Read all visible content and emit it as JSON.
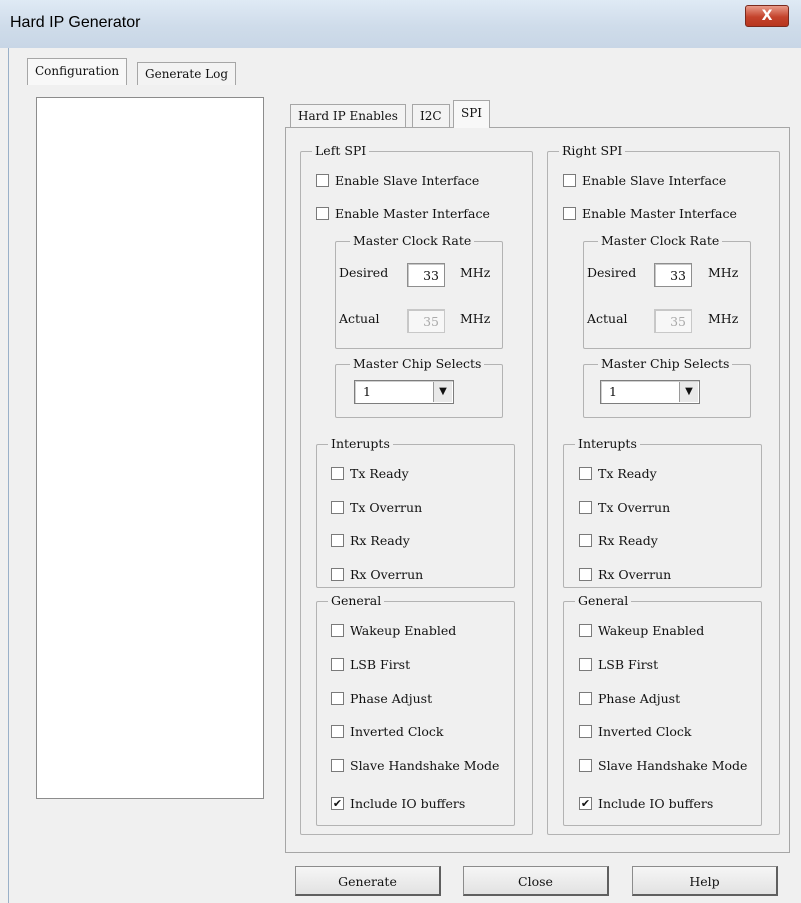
{
  "window": {
    "title": "Hard IP Generator",
    "close_glyph": "X"
  },
  "main_tabs": [
    {
      "label": "Configuration",
      "active": true
    },
    {
      "label": "Generate Log",
      "active": false
    }
  ],
  "sub_tabs": [
    {
      "label": "Hard IP Enables",
      "active": false
    },
    {
      "label": "I2C",
      "active": false
    },
    {
      "label": "SPI",
      "active": true
    }
  ],
  "spi": {
    "left": {
      "title": "Left SPI",
      "enable_slave": {
        "label": "Enable Slave Interface",
        "checked": false
      },
      "enable_master": {
        "label": "Enable Master Interface",
        "checked": false
      },
      "clock_rate": {
        "title": "Master Clock Rate",
        "desired_label": "Desired",
        "desired_value": "33",
        "desired_unit": "MHz",
        "actual_label": "Actual",
        "actual_value": "35",
        "actual_unit": "MHz"
      },
      "chip_selects": {
        "title": "Master Chip Selects",
        "value": "1"
      },
      "interrupts": {
        "title": "Interupts",
        "items": [
          {
            "label": "Tx Ready",
            "checked": false
          },
          {
            "label": "Tx Overrun",
            "checked": false
          },
          {
            "label": "Rx Ready",
            "checked": false
          },
          {
            "label": "Rx Overrun",
            "checked": false
          }
        ]
      },
      "general": {
        "title": "General",
        "items": [
          {
            "label": "Wakeup Enabled",
            "checked": false
          },
          {
            "label": "LSB First",
            "checked": false
          },
          {
            "label": "Phase Adjust",
            "checked": false
          },
          {
            "label": "Inverted Clock",
            "checked": false
          },
          {
            "label": "Slave Handshake Mode",
            "checked": false
          },
          {
            "label": "Include IO buffers",
            "checked": true
          }
        ]
      }
    },
    "right": {
      "title": "Right SPI",
      "enable_slave": {
        "label": "Enable Slave Interface",
        "checked": false
      },
      "enable_master": {
        "label": "Enable Master Interface",
        "checked": false
      },
      "clock_rate": {
        "title": "Master Clock Rate",
        "desired_label": "Desired",
        "desired_value": "33",
        "desired_unit": "MHz",
        "actual_label": "Actual",
        "actual_value": "35",
        "actual_unit": "MHz"
      },
      "chip_selects": {
        "title": "Master Chip Selects",
        "value": "1"
      },
      "interrupts": {
        "title": "Interupts",
        "items": [
          {
            "label": "Tx Ready",
            "checked": false
          },
          {
            "label": "Tx Overrun",
            "checked": false
          },
          {
            "label": "Rx Ready",
            "checked": false
          },
          {
            "label": "Rx Overrun",
            "checked": false
          }
        ]
      },
      "general": {
        "title": "General",
        "items": [
          {
            "label": "Wakeup Enabled",
            "checked": false
          },
          {
            "label": "LSB First",
            "checked": false
          },
          {
            "label": "Phase Adjust",
            "checked": false
          },
          {
            "label": "Inverted Clock",
            "checked": false
          },
          {
            "label": "Slave Handshake Mode",
            "checked": false
          },
          {
            "label": "Include IO buffers",
            "checked": true
          }
        ]
      }
    }
  },
  "buttons": {
    "generate": "Generate",
    "close": "Close",
    "help": "Help"
  },
  "check_glyph": "✔"
}
